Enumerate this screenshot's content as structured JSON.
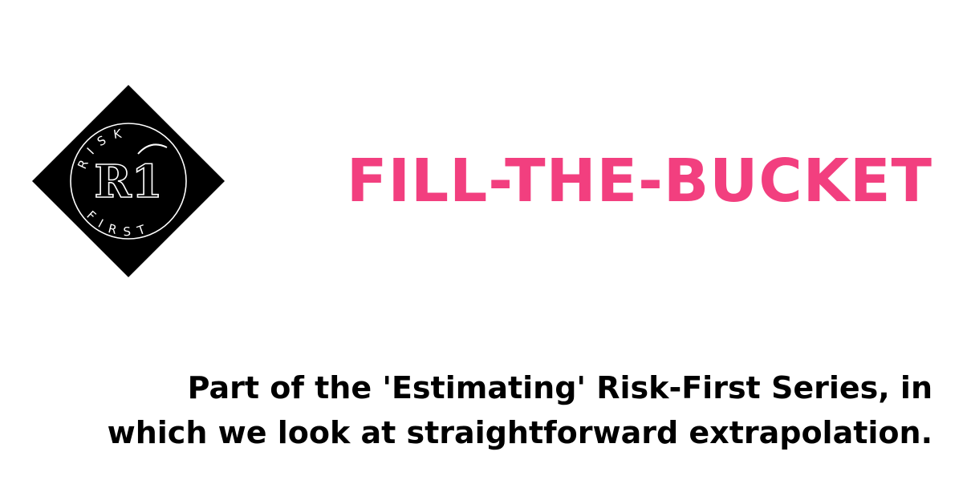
{
  "colors": {
    "title": "#f23f7f",
    "text": "#000000",
    "logo_bg": "#000000",
    "logo_fg": "#ffffff"
  },
  "logo": {
    "icon": "risk-first-logo",
    "top_text": "RISK",
    "bottom_text": "FIRST",
    "monogram": "R1"
  },
  "title": "FILL-THE-BUCKET",
  "subtitle": {
    "line1": "Part of the 'Estimating' Risk-First Series, in",
    "line2": "which we look at straightforward extrapolation."
  }
}
